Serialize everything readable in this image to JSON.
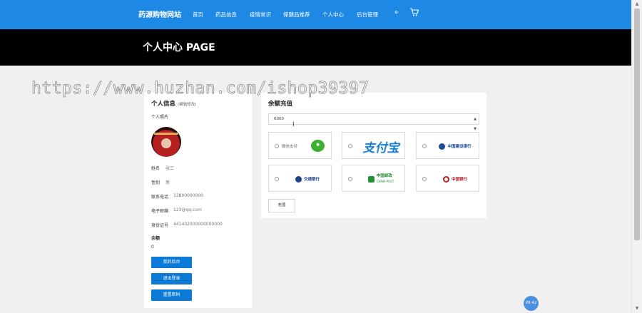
{
  "navbar": {
    "brand": "药源购物网站",
    "items": [
      "首页",
      "药品信息",
      "疫情常识",
      "保健品推荐",
      "个人中心",
      "后台管理"
    ],
    "chat_icon": "chat-bubble-icon",
    "cart_icon": "cart-icon",
    "bg_color": "#1e88e5"
  },
  "banner": {
    "title": "个人中心 PAGE"
  },
  "profile": {
    "title": "个人信息",
    "hint": "(编辑修改)",
    "photo_label": "个人照片",
    "fields": [
      {
        "label": "姓名",
        "value": "张三"
      },
      {
        "label": "性别",
        "value": "男"
      },
      {
        "label": "联系电话",
        "value": "13800000000"
      },
      {
        "label": "电子邮箱",
        "value": "123@qq.com"
      },
      {
        "label": "身份证号",
        "value": "441402000000000000"
      }
    ],
    "balance_label": "余额",
    "balance_value": "0",
    "buttons": [
      "我的后台",
      "退出登录",
      "重置密码"
    ]
  },
  "recharge": {
    "title": "余额充值",
    "amount": "6000",
    "wechat_label": "微信支付",
    "alipay_logo": "支付宝",
    "banks": [
      "中国建设银行",
      "交通银行",
      "中国邮政",
      "中国银行"
    ],
    "china_post_en": "CHINA POST",
    "submit_label": "充值"
  },
  "watermark": "https://www.huzhan.com/ishop39397",
  "timer": "09:42"
}
